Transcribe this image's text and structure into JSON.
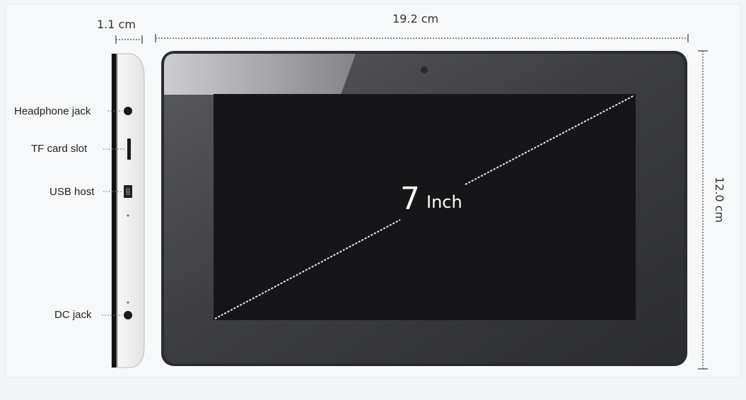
{
  "dimensions": {
    "thickness": "1.1 cm",
    "width": "19.2 cm",
    "height": "12.0 cm"
  },
  "ports": {
    "headphone": "Headphone jack",
    "tf_card": "TF card slot",
    "usb": "USB host",
    "dc": "DC jack"
  },
  "screen": {
    "size_number": "7",
    "size_unit": "Inch"
  },
  "colors": {
    "background": "#f2f4f6",
    "bezel": "#3a3b3e",
    "screen": "#141417",
    "side_body": "#f8f8f8"
  }
}
